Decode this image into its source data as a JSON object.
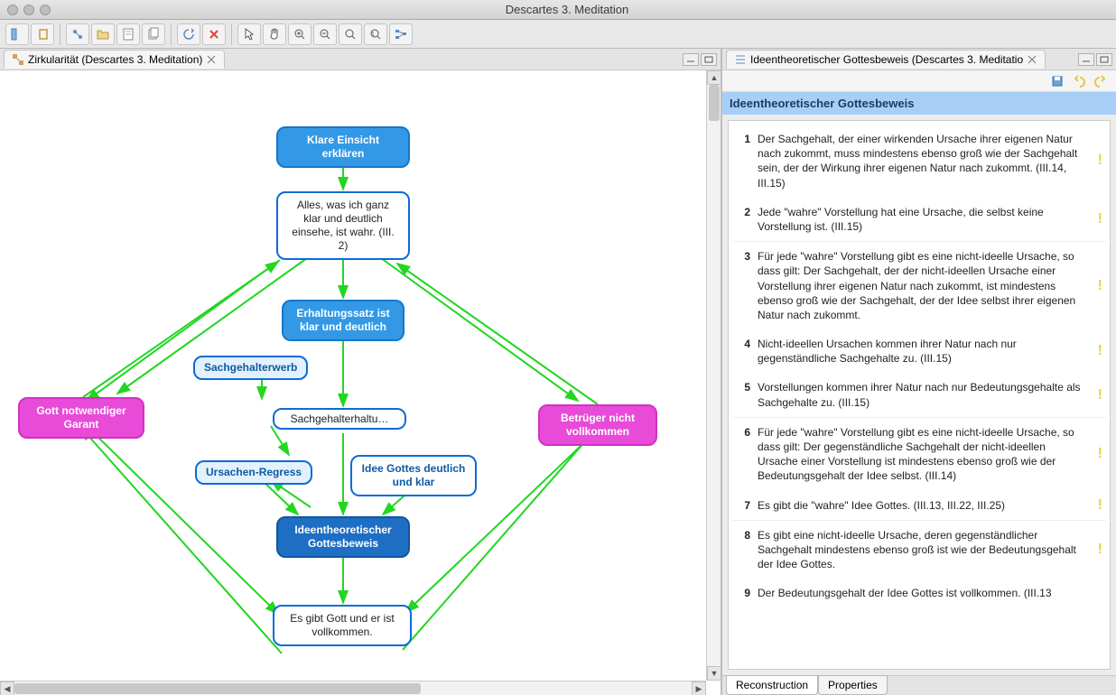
{
  "window": {
    "title": "Descartes 3. Meditation"
  },
  "left": {
    "tab_label": "Zirkularität (Descartes 3. Meditation)",
    "nodes": {
      "klare": "Klare Einsicht erklären",
      "alles": "Alles, was ich ganz klar und deutlich einsehe, ist wahr. (III. 2)",
      "erhaltung": "Erhaltungssatz ist klar und deutlich",
      "sachgehalt_erwerb": "Sachgehalterwerb",
      "sachgehalt_erhalt": "Sachgehalterhaltu…",
      "ursachen": "Ursachen-Regress",
      "idee_gottes": "Idee Gottes deutlich und klar",
      "ideentheorie": "Ideentheoretischer Gottesbeweis",
      "es_gibt": "Es gibt Gott und er ist vollkommen.",
      "gott_garant": "Gott notwendiger Garant",
      "betrueger": "Betrüger nicht vollkommen"
    }
  },
  "right": {
    "tab_label": "Ideentheoretischer Gottesbeweis (Descartes 3. Meditatio",
    "header": "Ideentheoretischer Gottesbeweis",
    "items": [
      {
        "n": "1",
        "t": "Der Sachgehalt, der einer wirkenden Ursache ihrer eigenen Natur nach zukommt, muss mindestens ebenso groß wie der Sachgehalt sein, der der Wirkung ihrer eigenen Natur nach zukommt. (III.14, III.15)"
      },
      {
        "n": "2",
        "t": "Jede \"wahre\" Vorstellung hat eine Ursache, die selbst keine Vorstellung ist. (III.15)"
      },
      {
        "n": "3",
        "t": "Für jede \"wahre\" Vorstellung gibt es eine nicht-ideelle Ursache, so dass gilt: Der Sachgehalt, der der nicht-ideellen Ursache einer Vorstellung ihrer eigenen Natur nach zukommt, ist mindestens ebenso groß wie der Sachgehalt, der der Idee selbst ihrer eigenen Natur nach zukommt."
      },
      {
        "n": "4",
        "t": "Nicht-ideellen Ursachen kommen ihrer Natur nach nur gegenständliche Sachgehalte zu. (III.15)"
      },
      {
        "n": "5",
        "t": "Vorstellungen kommen ihrer Natur nach nur Bedeutungsgehalte als Sachgehalte zu. (III.15)"
      },
      {
        "n": "6",
        "t": "Für jede \"wahre\" Vorstellung gibt es eine nicht-ideelle Ursache, so dass gilt: Der gegenständliche Sachgehalt der nicht-ideellen Ursache einer Vorstellung ist mindestens ebenso groß wie der Bedeutungsgehalt der Idee selbst. (III.14)"
      },
      {
        "n": "7",
        "t": "Es gibt die \"wahre\" Idee Gottes. (III.13, III.22, III.25)"
      },
      {
        "n": "8",
        "t": "Es gibt eine nicht-ideelle Ursache, deren gegenständlicher Sachgehalt mindestens ebenso groß ist wie der Bedeutungsgehalt der Idee Gottes."
      },
      {
        "n": "9",
        "t": "Der Bedeutungsgehalt der Idee Gottes ist vollkommen. (III.13"
      }
    ],
    "bottom_tabs": {
      "reconstruction": "Reconstruction",
      "properties": "Properties"
    }
  }
}
